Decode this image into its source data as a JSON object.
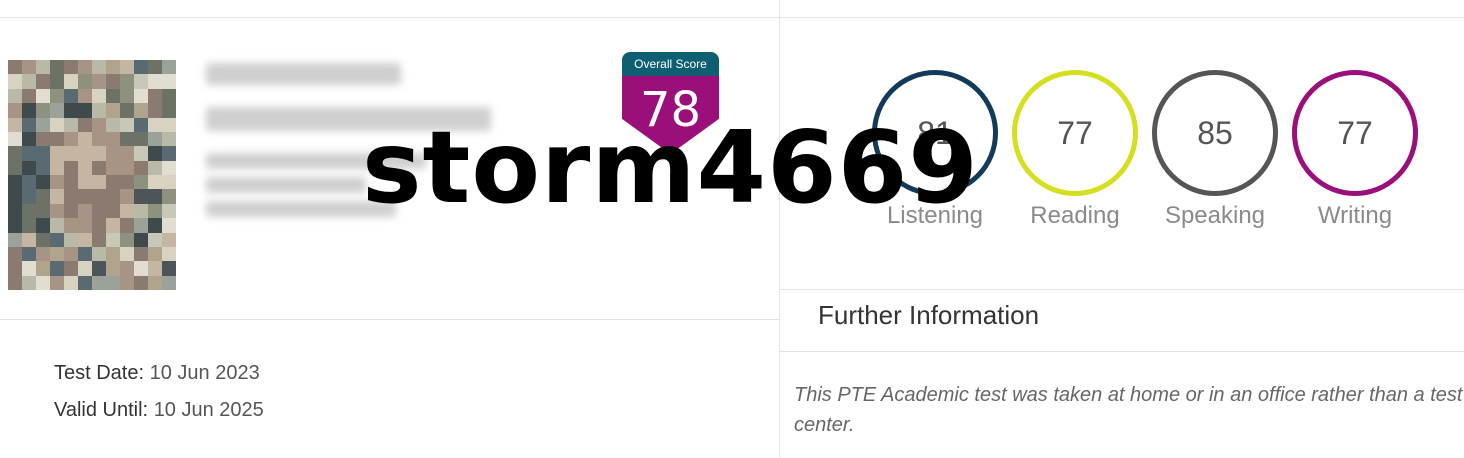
{
  "overall": {
    "label": "Overall Score",
    "score": "78",
    "colors": {
      "header": "#0f5f73",
      "body": "#9b0f7a"
    }
  },
  "watermark": "storm4669",
  "dates": {
    "test_label": "Test Date:",
    "test_value": "10 Jun 2023",
    "valid_label": "Valid Until:",
    "valid_value": "10 Jun 2025"
  },
  "skills": [
    {
      "name": "Listening",
      "score": "81",
      "color": "#123a5a"
    },
    {
      "name": "Reading",
      "score": "77",
      "color": "#d4df1f"
    },
    {
      "name": "Speaking",
      "score": "85",
      "color": "#555555"
    },
    {
      "name": "Writing",
      "score": "77",
      "color": "#9b0f7a"
    }
  ],
  "further": {
    "title": "Further Information",
    "text": "This PTE Academic test was taken at home or in an office rather than a test center."
  }
}
